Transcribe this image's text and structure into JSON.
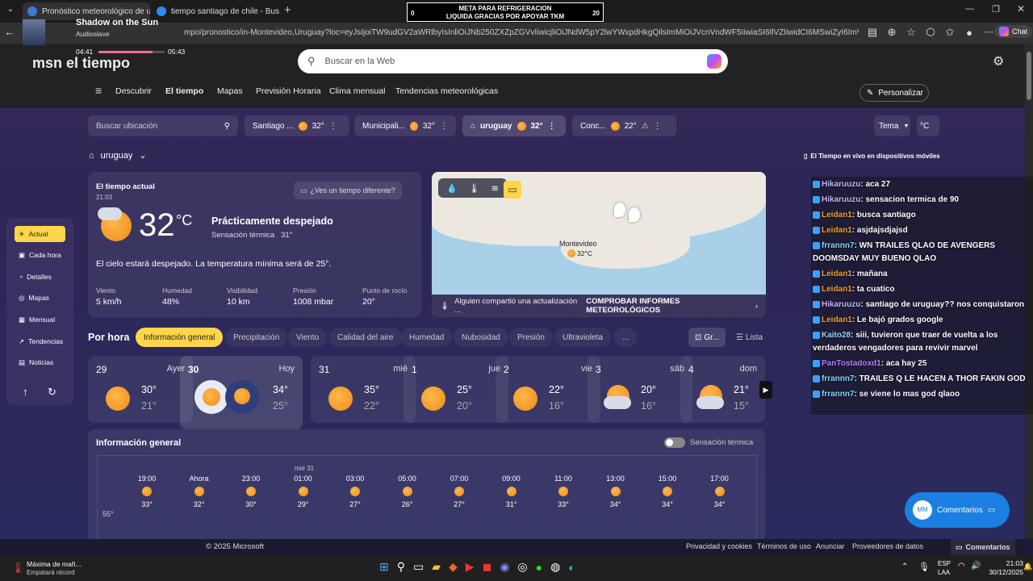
{
  "browser": {
    "tabs": [
      {
        "label": "Pronóstico meteorológico de urug",
        "active": true
      },
      {
        "label": "tiempo santiago de chile - Buscar",
        "active": false
      }
    ],
    "url": "mpo/pronostico/in-Montevideo,Uruguay?loc=eyJsIjoiTW9udGV2aWRlbyIsInliOiJNb250ZXZpZGVvIiwicjliOiJNdW5pY2lwYWxpdHkgQilsImMiOiJVcnVndWF5IiwiaSI6IlVZIiwidCI6MSwiZyI6ImVzLXhsliwieCI6...",
    "chat_label": "Chat"
  },
  "media": {
    "title": "Shadow on the Sun",
    "artist": "Audioslave",
    "elapsed": "04:41",
    "total": "05:43"
  },
  "banner": {
    "left": "0",
    "line1": "META PARA REFRIGERACION",
    "line2": "LIQUIDA GRACIAS POR APOYAR TKM",
    "right": "20"
  },
  "msn": {
    "logo": "msn el tiempo",
    "search_placeholder": "Buscar en la Web",
    "nav": [
      "Descubrir",
      "El tiempo",
      "Mapas",
      "Previsión Horaria",
      "Clima mensual",
      "Tendencias meteorológicas"
    ],
    "personalize": "Personalizar"
  },
  "locations": {
    "search_placeholder": "Buscar ubicación",
    "chips": [
      {
        "name": "Santiago ...",
        "temp": "32°"
      },
      {
        "name": "Municipali...",
        "temp": "32°"
      },
      {
        "name": "uruguay",
        "temp": "32°"
      },
      {
        "name": "Conc...",
        "temp": "22°"
      }
    ],
    "theme": "Tema",
    "unit": "°C"
  },
  "location_title": "uruguay",
  "mobile_link": "El Tiempo en vivo en dispositivos móviles",
  "sidebar": {
    "items": [
      "Actual",
      "Cada hora",
      "Detalles",
      "Mapas",
      "Mensual",
      "Tendencias",
      "Noticias"
    ]
  },
  "current": {
    "title": "El tiempo actual",
    "time": "21:03",
    "different": "¿Ves un tiempo diferente?",
    "temp": "32",
    "unit": "°C",
    "condition": "Prácticamente despejado",
    "feels": "Sensación térmica   31°",
    "summary": "El cielo estará despejado. La temperatura mínima será de 25°.",
    "stats": [
      {
        "label": "Viento",
        "value": "5 km/h"
      },
      {
        "label": "Humedad",
        "value": "48%"
      },
      {
        "label": "Visibilidad",
        "value": "10 km"
      },
      {
        "label": "Presión",
        "value": "1008 mbar"
      },
      {
        "label": "Punto de rocío",
        "value": "20°"
      }
    ]
  },
  "map": {
    "city": "Montevideo",
    "city_temp": "32°C",
    "banner": "Alguien compartió una actualización ...",
    "action": "COMPROBAR INFORMES METEOROLÓGICOS"
  },
  "hourly": {
    "title": "Por hora",
    "pills": [
      "Información general",
      "Precipitación",
      "Viento",
      "Calidad del aire",
      "Humedad",
      "Nubosidad",
      "Presión",
      "Ultravioleta",
      "..."
    ],
    "view_graph": "Gr...",
    "view_list": "Lista"
  },
  "days": [
    {
      "num": "29",
      "name": "Ayer",
      "hi": "30°",
      "lo": "21°"
    },
    {
      "num": "30",
      "name": "Hoy",
      "hi": "34°",
      "lo": "25°"
    },
    {
      "num": "31",
      "name": "mié",
      "hi": "35°",
      "lo": "22°"
    },
    {
      "num": "1",
      "name": "jue",
      "hi": "25°",
      "lo": "20°"
    },
    {
      "num": "2",
      "name": "vie",
      "hi": "22°",
      "lo": "16°"
    },
    {
      "num": "3",
      "name": "sáb",
      "hi": "20°",
      "lo": "16°"
    },
    {
      "num": "4",
      "name": "dom",
      "hi": "21°",
      "lo": "15°"
    }
  ],
  "general": {
    "title": "Información general",
    "toggle": "Sensación térmica",
    "date_marker": "mié 31",
    "axis_label": "55°",
    "hours": [
      {
        "time": "19:00",
        "temp": "33°"
      },
      {
        "time": "Ahora",
        "temp": "32°"
      },
      {
        "time": "23:00",
        "temp": "30°"
      },
      {
        "time": "01:00",
        "temp": "29°"
      },
      {
        "time": "03:00",
        "temp": "27°"
      },
      {
        "time": "05:00",
        "temp": "26°"
      },
      {
        "time": "07:00",
        "temp": "27°"
      },
      {
        "time": "09:00",
        "temp": "31°"
      },
      {
        "time": "11:00",
        "temp": "33°"
      },
      {
        "time": "13:00",
        "temp": "34°"
      },
      {
        "time": "15:00",
        "temp": "34°"
      },
      {
        "time": "17:00",
        "temp": "34°"
      }
    ]
  },
  "comments_button": "Comentarios",
  "comments_avatar": "MM",
  "footer": {
    "copyright": "© 2025 Microsoft",
    "links": [
      "Privacidad y cookies",
      "Términos de uso",
      "Anunciar",
      "Proveedores de datos"
    ],
    "comments": "Comentarios"
  },
  "chat": [
    {
      "user": "Hikaruuzu",
      "color": "#c8b4ff",
      "text": ": aca 27"
    },
    {
      "user": "Hikaruuzu",
      "color": "#c8b4ff",
      "text": ": sensacion termica de 90"
    },
    {
      "user": "Leidan1",
      "color": "#f0a030",
      "text": ": busca santiago"
    },
    {
      "user": "Leidan1",
      "color": "#f0a030",
      "text": ": asjdajsdjajsd"
    },
    {
      "user": "frrannn7",
      "color": "#7dd8ff",
      "text": ": WN TRAILES QLAO DE AVENGERS DOOMSDAY MUY BUENO QLAO"
    },
    {
      "user": "Leidan1",
      "color": "#f0a030",
      "text": ": mañana"
    },
    {
      "user": "Leidan1",
      "color": "#f0a030",
      "text": ": ta cuatico"
    },
    {
      "user": "Hikaruuzu",
      "color": "#c8b4ff",
      "text": ": santiago de uruguay?? nos conquistaron"
    },
    {
      "user": "Leidan1",
      "color": "#f0a030",
      "text": ": Le bajó grados google"
    },
    {
      "user": "Kaito28",
      "color": "#9ad4ff",
      "text": ": siii, tuvieron que traer de vuelta a los verdaderos vengadores para revivir marvel"
    },
    {
      "user": "PanTostadoxd1",
      "color": "#c07cff",
      "text": ": aca hay 25"
    },
    {
      "user": "frrannn7",
      "color": "#7dd8ff",
      "text": ": TRAILES Q LE HACEN A THOR FAKIN GOD"
    },
    {
      "user": "frrannn7",
      "color": "#7dd8ff",
      "text": ": se viene lo mas god qlaoo"
    }
  ],
  "taskbar": {
    "weather_title": "Máxima de mañ...",
    "weather_sub": "Empatará récord",
    "lang": "ESP",
    "lang2": "LAA",
    "time": "21:03",
    "date": "30/12/2025"
  },
  "colors": {
    "accent_yellow": "#ffd54a",
    "comments_blue": "#1a7fe0"
  }
}
